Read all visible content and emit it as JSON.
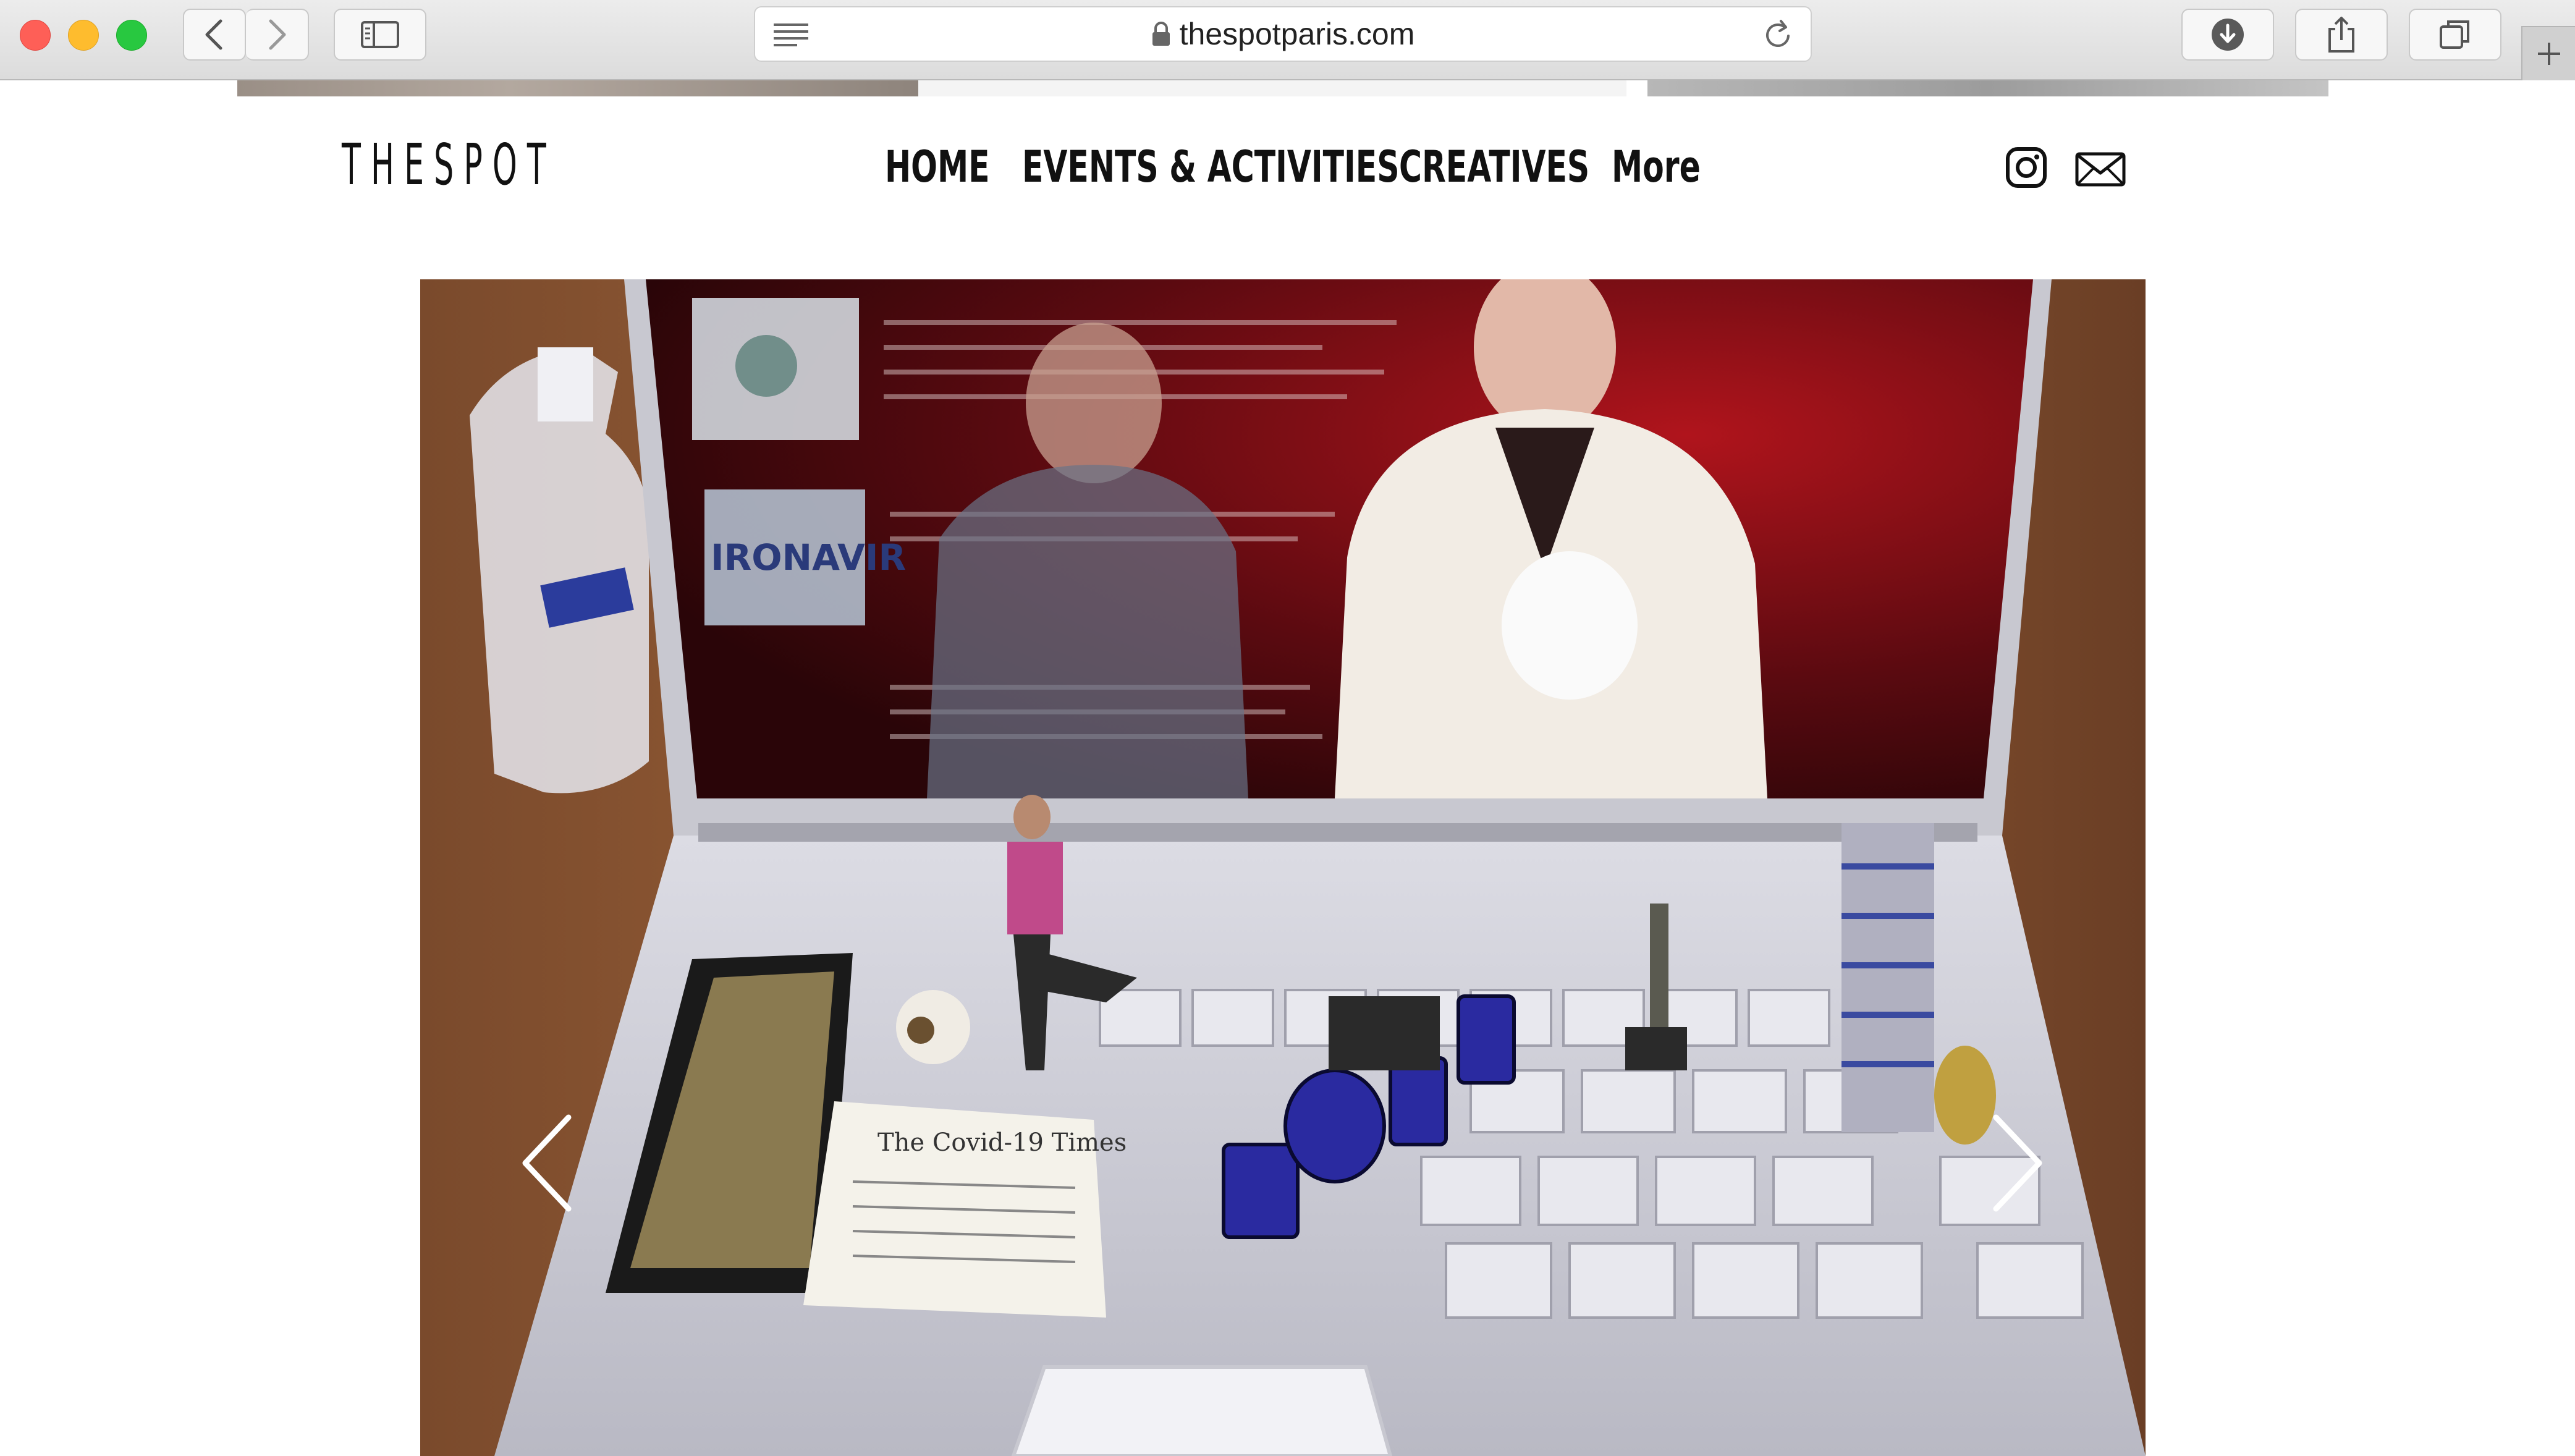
{
  "browser": {
    "url": "thespotparis.com"
  },
  "site": {
    "logo": "T H E  S P O T",
    "nav": [
      {
        "label": "HOME"
      },
      {
        "label": "EVENTS & ACTIVITIES"
      },
      {
        "label": "CREATIVES"
      },
      {
        "label": "More"
      }
    ]
  },
  "slideshow": {
    "image_text": [
      "IRONAVIR",
      "The Covid-19 Times"
    ]
  },
  "colors": {
    "traffic_red": "#fe5f57",
    "traffic_yellow": "#febc2e",
    "traffic_green": "#28c840",
    "screen_red": "#6e0d12",
    "laptop_silver": "#cfcfd6"
  }
}
